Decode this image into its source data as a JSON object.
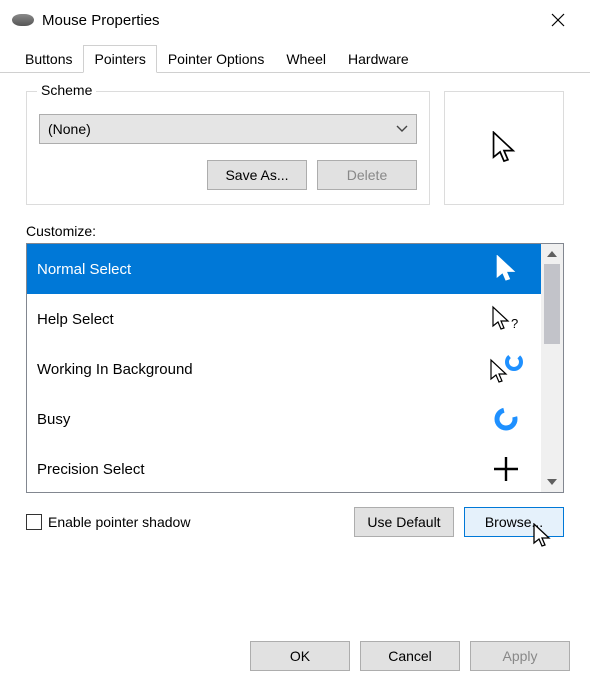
{
  "window": {
    "title": "Mouse Properties"
  },
  "tabs": {
    "items": [
      {
        "label": "Buttons"
      },
      {
        "label": "Pointers"
      },
      {
        "label": "Pointer Options"
      },
      {
        "label": "Wheel"
      },
      {
        "label": "Hardware"
      }
    ],
    "active_index": 1
  },
  "scheme": {
    "legend": "Scheme",
    "selected": "(None)",
    "save_as_label": "Save As...",
    "delete_label": "Delete"
  },
  "customize": {
    "label": "Customize:",
    "items": [
      {
        "label": "Normal Select",
        "icon": "cursor-arrow",
        "selected": true
      },
      {
        "label": "Help Select",
        "icon": "cursor-help",
        "selected": false
      },
      {
        "label": "Working In Background",
        "icon": "cursor-working",
        "selected": false
      },
      {
        "label": "Busy",
        "icon": "cursor-busy",
        "selected": false
      },
      {
        "label": "Precision Select",
        "icon": "cursor-precision",
        "selected": false
      }
    ]
  },
  "options": {
    "enable_shadow_label": "Enable pointer shadow",
    "enable_shadow_checked": false,
    "use_default_label": "Use Default",
    "browse_label": "Browse..."
  },
  "footer": {
    "ok": "OK",
    "cancel": "Cancel",
    "apply": "Apply"
  },
  "icons": {
    "mouse": "mouse-icon",
    "close": "close-icon",
    "chevron_down": "chevron-down-icon",
    "scroll_up": "scroll-up-icon",
    "scroll_down": "scroll-down-icon"
  }
}
